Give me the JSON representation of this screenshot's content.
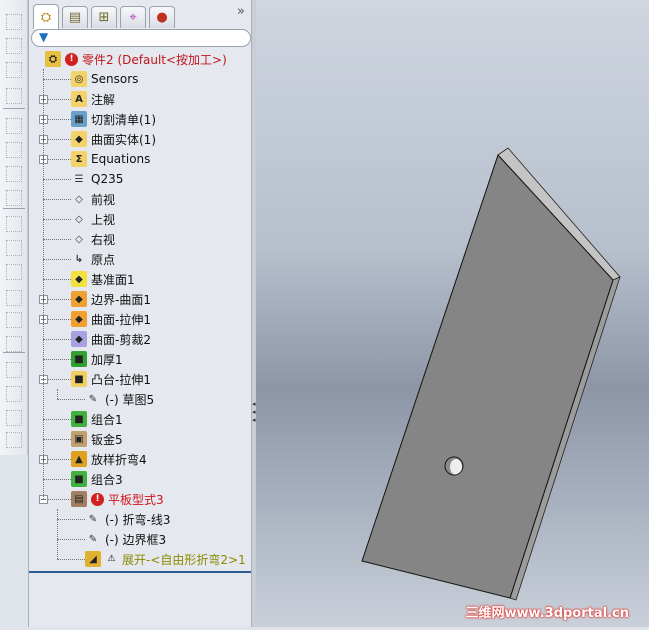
{
  "tabs": [
    {
      "name": "featuremanager-tab",
      "icon": "feature-tree-icon",
      "glyph": "⛭"
    },
    {
      "name": "propertymanager-tab",
      "icon": "property-icon",
      "glyph": "▤"
    },
    {
      "name": "configuration-tab",
      "icon": "configuration-icon",
      "glyph": "⊞"
    },
    {
      "name": "dimxpert-tab",
      "icon": "crosshair-icon",
      "glyph": "⌖"
    },
    {
      "name": "display-tab",
      "icon": "appearance-icon",
      "glyph": "●"
    }
  ],
  "more": "»",
  "filter_icon": "filter-icon",
  "tree": [
    {
      "label": "零件2  (Default<按加工>)",
      "level": 0,
      "color": "#c0161c",
      "icon": "part-icon",
      "status": "error"
    },
    {
      "label": "Sensors",
      "level": 1,
      "icon": "sensors-folder-icon"
    },
    {
      "label": "注解",
      "level": 1,
      "icon": "annotations-folder-icon",
      "expand": "+"
    },
    {
      "label": "切割清单(1)",
      "level": 1,
      "icon": "cut-list-icon",
      "expand": "+"
    },
    {
      "label": "曲面实体(1)",
      "level": 1,
      "icon": "surface-bodies-folder-icon",
      "expand": "+"
    },
    {
      "label": "Equations",
      "level": 1,
      "icon": "equations-folder-icon",
      "expand": "+"
    },
    {
      "label": "Q235",
      "level": 1,
      "icon": "material-icon"
    },
    {
      "label": "前视",
      "level": 1,
      "icon": "plane-icon"
    },
    {
      "label": "上视",
      "level": 1,
      "icon": "plane-icon"
    },
    {
      "label": "右视",
      "level": 1,
      "icon": "plane-icon"
    },
    {
      "label": "原点",
      "level": 1,
      "icon": "origin-icon"
    },
    {
      "label": "基准面1",
      "level": 1,
      "icon": "ref-plane-icon"
    },
    {
      "label": "边界-曲面1",
      "level": 1,
      "icon": "boundary-surface-icon",
      "expand": "+"
    },
    {
      "label": "曲面-拉伸1",
      "level": 1,
      "icon": "extrude-surface-icon",
      "expand": "+"
    },
    {
      "label": "曲面-剪裁2",
      "level": 1,
      "icon": "trim-surface-icon"
    },
    {
      "label": "加厚1",
      "level": 1,
      "icon": "thicken-icon"
    },
    {
      "label": "凸台-拉伸1",
      "level": 1,
      "icon": "boss-extrude-icon",
      "expand": "−"
    },
    {
      "label": "(-) 草图5",
      "level": 2,
      "icon": "sketch-icon"
    },
    {
      "label": "组合1",
      "level": 1,
      "icon": "combine-icon"
    },
    {
      "label": "钣金5",
      "level": 1,
      "icon": "sheet-metal-icon"
    },
    {
      "label": "放样折弯4",
      "level": 1,
      "icon": "lofted-bend-icon",
      "expand": "+"
    },
    {
      "label": "组合3",
      "level": 1,
      "icon": "combine-icon"
    },
    {
      "label": "平板型式3",
      "level": 1,
      "color": "#d0161c",
      "icon": "flat-pattern-icon",
      "status": "error",
      "expand": "−"
    },
    {
      "label": "(-) 折弯-线3",
      "level": 2,
      "icon": "sketch-icon"
    },
    {
      "label": "(-) 边界框3",
      "level": 2,
      "icon": "sketch-icon"
    },
    {
      "label": "展开-<自由形折弯2>1",
      "level": 2,
      "color": "#8a8a00",
      "icon": "flatten-icon",
      "status": "warning"
    }
  ],
  "watermark": "三维网www.3dportal.cn"
}
